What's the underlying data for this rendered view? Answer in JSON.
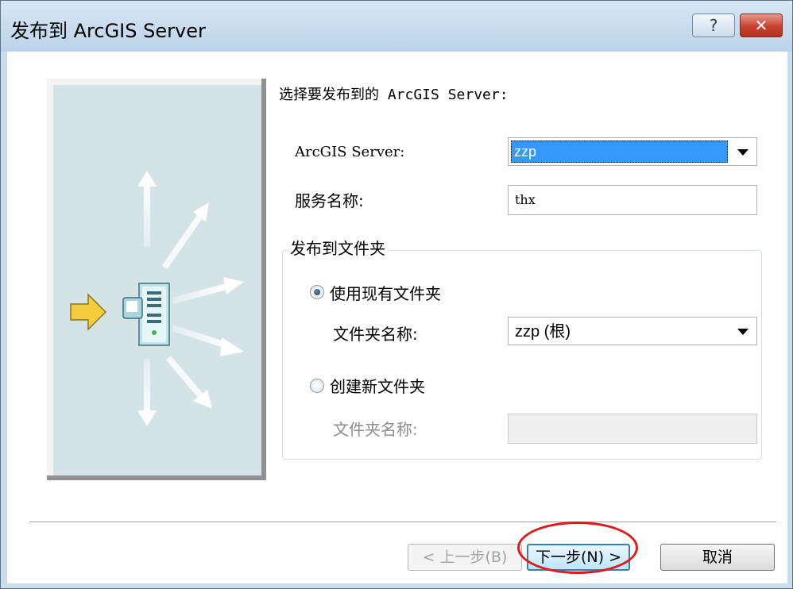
{
  "window": {
    "title": "发布到 ArcGIS Server",
    "help_glyph": "?",
    "close_glyph": "✕"
  },
  "heading": "选择要发布到的 ArcGIS Server:",
  "server_field": {
    "label": "ArcGIS Server:",
    "value": "zzp"
  },
  "service_name": {
    "label": "服务名称:",
    "value": "thx"
  },
  "folder_group": {
    "legend": "发布到文件夹",
    "use_existing": {
      "label": "使用现有文件夹",
      "selected": true,
      "folder_label": "文件夹名称:",
      "folder_value": "zzp (根)"
    },
    "create_new": {
      "label": "创建新文件夹",
      "selected": false,
      "folder_label": "文件夹名称:",
      "folder_value": ""
    }
  },
  "buttons": {
    "back": "< 上一步(B)",
    "next": "下一步(N) >",
    "cancel": "取消"
  },
  "colors": {
    "selection": "#3399ff",
    "annotation": "#e01a1a",
    "illustration_bg": "#d4e4e6",
    "arrow_yellow": "#f2cc3a"
  }
}
